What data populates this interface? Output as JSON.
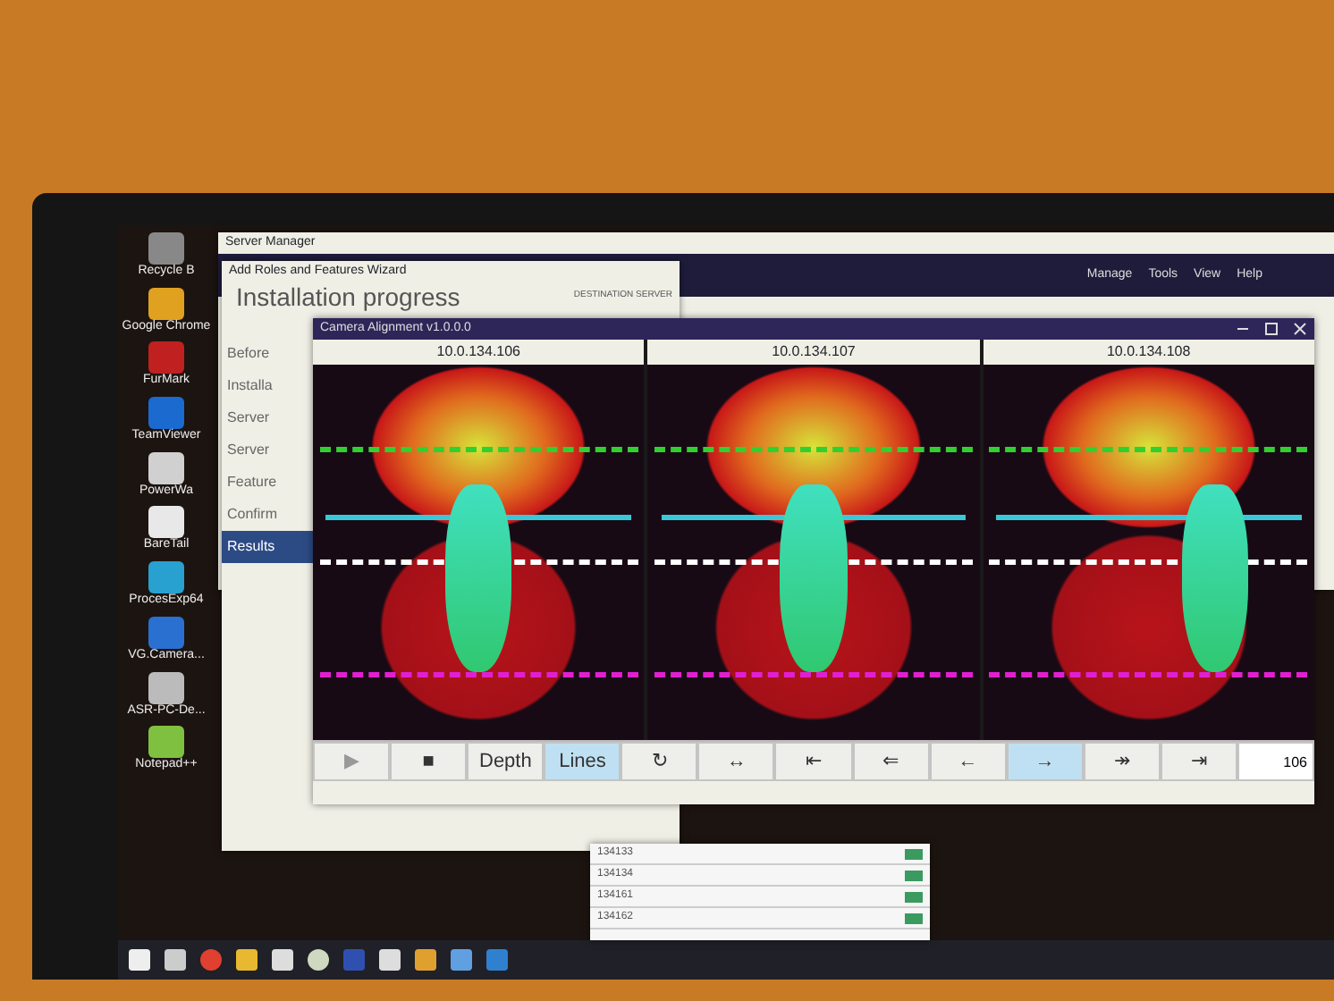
{
  "desktop": {
    "icons": [
      {
        "label": "Recycle B"
      },
      {
        "label": "Google Chrome"
      },
      {
        "label": "FurMark"
      },
      {
        "label": "TeamViewer"
      },
      {
        "label": "PowerWa"
      },
      {
        "label": "BareTail"
      },
      {
        "label": "ProcesExp64"
      },
      {
        "label": "VG.Camera..."
      },
      {
        "label": "ASR-PC-De..."
      },
      {
        "label": "Notepad++"
      }
    ]
  },
  "server_manager": {
    "title": "Server Manager",
    "menu": [
      "Manage",
      "Tools",
      "View",
      "Help"
    ]
  },
  "wizard": {
    "title": "Add Roles and Features Wizard",
    "heading": "Installation progress",
    "destination": "DESTINATION SERVER",
    "steps": [
      {
        "label": "Before",
        "selected": false
      },
      {
        "label": "Installa",
        "selected": false
      },
      {
        "label": "Server",
        "selected": false
      },
      {
        "label": "Server",
        "selected": false
      },
      {
        "label": "Feature",
        "selected": false
      },
      {
        "label": "Confirm",
        "selected": false
      },
      {
        "label": "Results",
        "selected": true
      }
    ]
  },
  "camera_window": {
    "title": "Camera Alignment v1.0.0.0",
    "cameras": [
      {
        "label": "10.0.134.106"
      },
      {
        "label": "10.0.134.107"
      },
      {
        "label": "10.0.134.108"
      }
    ],
    "toolbar": [
      {
        "label": "▶",
        "selected": false,
        "disabled": true
      },
      {
        "label": "■",
        "selected": false,
        "disabled": false
      },
      {
        "label": "Depth",
        "selected": false,
        "disabled": false
      },
      {
        "label": "Lines",
        "selected": true,
        "disabled": false
      },
      {
        "label": "↻",
        "selected": false,
        "disabled": false
      },
      {
        "label": "↔",
        "selected": false,
        "disabled": false
      },
      {
        "label": "⇤",
        "selected": false,
        "disabled": false
      },
      {
        "label": "⇐",
        "selected": false,
        "disabled": false
      },
      {
        "label": "←",
        "selected": false,
        "disabled": false
      },
      {
        "label": "→",
        "selected": true,
        "disabled": false
      },
      {
        "label": "↠",
        "selected": false,
        "disabled": false
      },
      {
        "label": "⇥",
        "selected": false,
        "disabled": false
      }
    ],
    "frame_field": "106"
  },
  "table": {
    "rows": [
      {
        "id": "134133"
      },
      {
        "id": "134134"
      },
      {
        "id": "134161"
      },
      {
        "id": "134162"
      }
    ]
  }
}
